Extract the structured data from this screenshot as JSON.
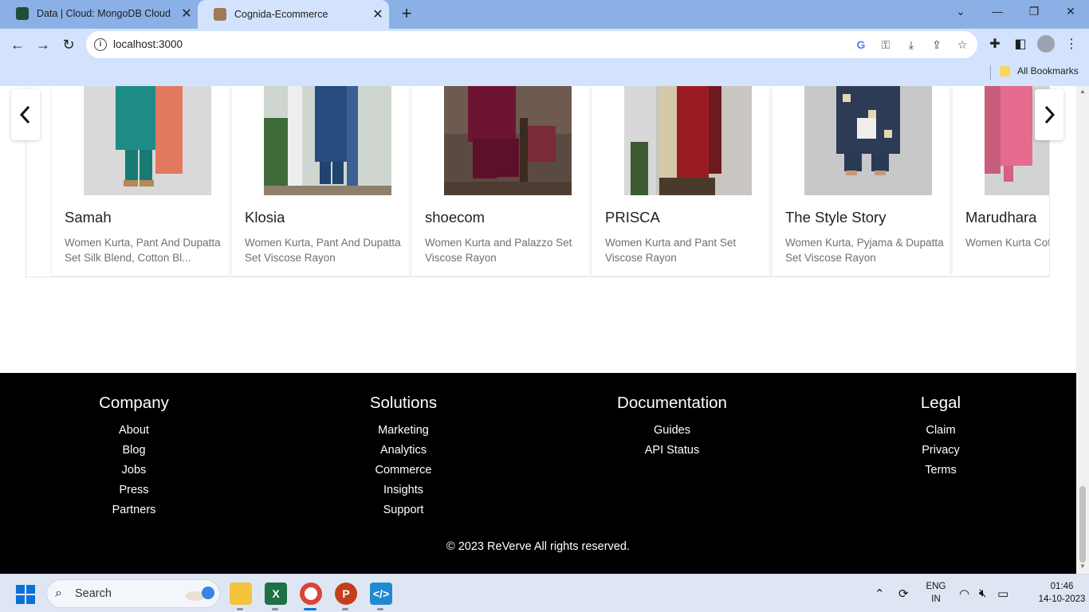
{
  "browser": {
    "tabs": [
      {
        "title": "Data | Cloud: MongoDB Cloud",
        "favicon_color": "#1b4f36",
        "favicon": "mongodb-leaf-icon"
      },
      {
        "title": "Cognida-Ecommerce",
        "favicon_color": "#9e7b55",
        "favicon": "site-thumbnail-icon"
      }
    ],
    "url": "localhost:3000",
    "bookmarks_label": "All Bookmarks"
  },
  "products": [
    {
      "brand": "Samah",
      "description": "Women Kurta, Pant And Dupatta Set Silk Blend, Cotton Bl..."
    },
    {
      "brand": "Klosia",
      "description": "Women Kurta, Pant And Dupatta Set Viscose Rayon"
    },
    {
      "brand": "shoecom",
      "description": "Women Kurta and Palazzo Set Viscose Rayon"
    },
    {
      "brand": "PRISCA",
      "description": "Women Kurta and Pant Set Viscose Rayon"
    },
    {
      "brand": "The Style Story",
      "description": "Women Kurta, Pyjama & Dupatta Set Viscose Rayon"
    },
    {
      "brand": "Marudhara",
      "description": "Women Kurta Cotton"
    }
  ],
  "footer": {
    "columns": [
      {
        "heading": "Company",
        "links": [
          "About",
          "Blog",
          "Jobs",
          "Press",
          "Partners"
        ]
      },
      {
        "heading": "Solutions",
        "links": [
          "Marketing",
          "Analytics",
          "Commerce",
          "Insights",
          "Support"
        ]
      },
      {
        "heading": "Documentation",
        "links": [
          "Guides",
          "API Status"
        ]
      },
      {
        "heading": "Legal",
        "links": [
          "Claim",
          "Privacy",
          "Terms"
        ]
      }
    ],
    "copyright": "© 2023 ReVerve All rights reserved."
  },
  "taskbar": {
    "search_label": "Search",
    "language_top": "ENG",
    "language_bottom": "IN",
    "time": "01:46",
    "date": "14-10-2023"
  }
}
